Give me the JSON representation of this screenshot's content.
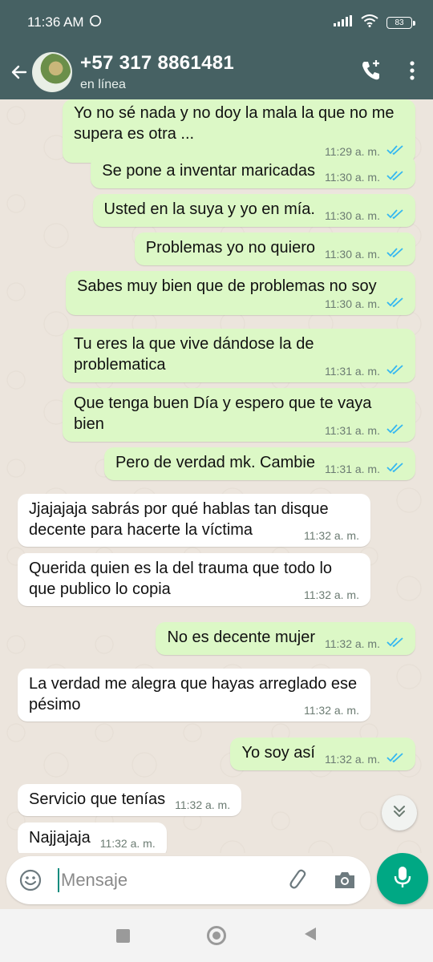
{
  "status_bar": {
    "time": "11:36 AM",
    "battery": "83"
  },
  "header": {
    "contact_name": "+57 317 8861481",
    "contact_status": "en línea"
  },
  "messages": [
    {
      "dir": "out",
      "text": "Yo no sé nada y no doy la mala la que no me supera es otra ...",
      "time": "11:29 a. m."
    },
    {
      "dir": "out",
      "text": "Se pone a inventar maricadas",
      "time": "11:30 a. m."
    },
    {
      "dir": "out",
      "text": "Usted en la suya y yo en mía.",
      "time": "11:30 a. m."
    },
    {
      "dir": "out",
      "text": "Problemas yo no quiero",
      "time": "11:30 a. m."
    },
    {
      "dir": "out",
      "text": "Sabes muy bien que de problemas no soy",
      "time": "11:30 a. m."
    },
    {
      "dir": "out",
      "text": "Tu eres la que vive dándose la de problematica",
      "time": "11:31 a. m."
    },
    {
      "dir": "out",
      "text": "Que tenga buen Día y espero que te vaya bien",
      "time": "11:31 a. m."
    },
    {
      "dir": "out",
      "text": "Pero de verdad mk. Cambie",
      "time": "11:31 a. m."
    },
    {
      "dir": "in",
      "text": "Jjajajaja sabrás por qué hablas tan disque decente para hacerte la víctima",
      "time": "11:32 a. m."
    },
    {
      "dir": "in",
      "text": "Querida quien es la del trauma que todo lo que publico lo copia",
      "time": "11:32 a. m."
    },
    {
      "dir": "out",
      "text": "No es decente mujer",
      "time": "11:32 a. m."
    },
    {
      "dir": "in",
      "text": "La verdad me alegra que hayas arreglado ese pésimo",
      "time": "11:32 a. m."
    },
    {
      "dir": "out",
      "text": "Yo soy así",
      "time": "11:32 a. m."
    },
    {
      "dir": "in",
      "text": "Servicio que tenías",
      "time": "11:32 a. m."
    },
    {
      "dir": "in",
      "text": "Najjajaja",
      "time": "11:32 a. m."
    }
  ],
  "composer": {
    "placeholder": "Mensaje"
  },
  "colors": {
    "header_bg": "#466163",
    "outgoing_bubble": "#dcf8c6",
    "incoming_bubble": "#ffffff",
    "read_ticks": "#34b7f1",
    "mic_button": "#00a884"
  },
  "icons": [
    "whatsapp-icon",
    "signal-icon",
    "wifi-icon",
    "back-arrow-icon",
    "add-call-icon",
    "more-vert-icon",
    "double-check-icon",
    "scroll-down-icon",
    "emoji-icon",
    "attach-icon",
    "camera-icon",
    "mic-icon"
  ]
}
